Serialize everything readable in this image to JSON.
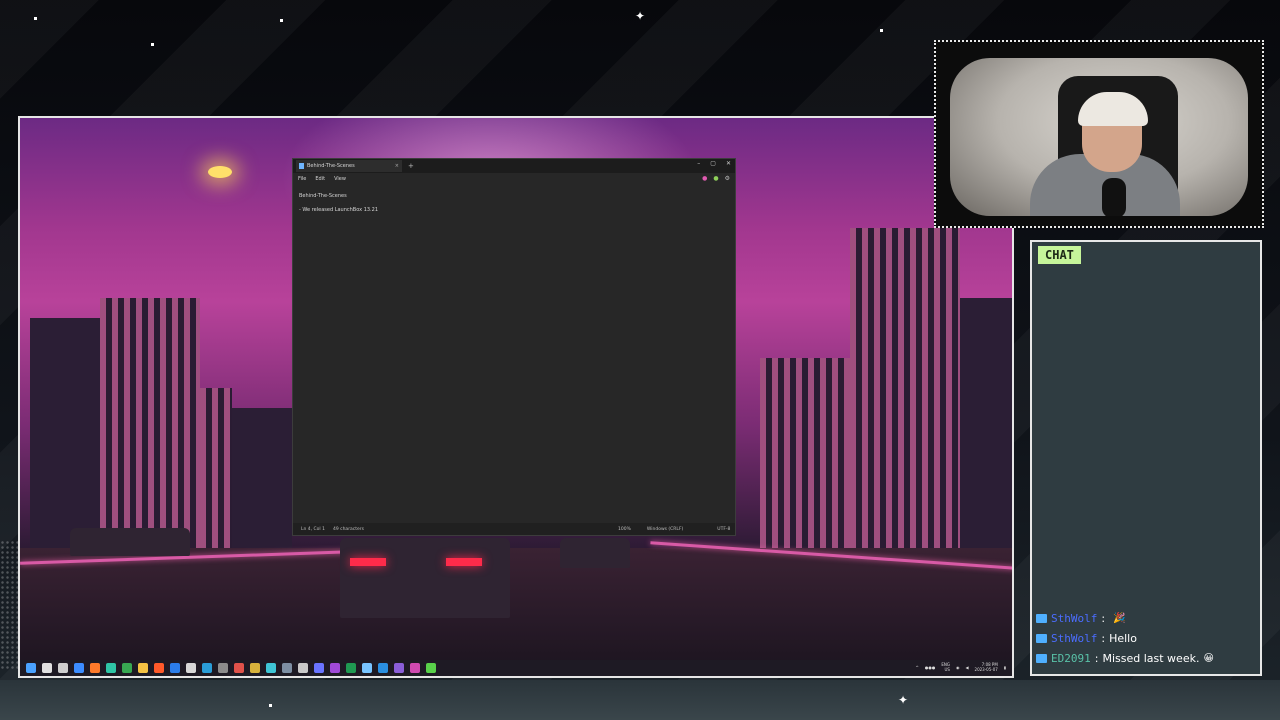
{
  "notepad": {
    "tab_title": "Behind-The-Scenes",
    "tab_close": "×",
    "new_tab": "+",
    "window_controls": [
      "–",
      "▢",
      "✕"
    ],
    "menu": [
      "File",
      "Edit",
      "View"
    ],
    "lines": [
      "Behind-The-Scenes",
      "- We released LaunchBox 13.21"
    ],
    "status": {
      "position": "Ln 4, Col 1",
      "characters": "49 characters",
      "zoom": "100%",
      "line_ending": "Windows (CRLF)",
      "encoding": "UTF-8"
    }
  },
  "taskbar": {
    "icons": [
      {
        "name": "start-icon",
        "color": "#4aa3ff"
      },
      {
        "name": "search-icon",
        "color": "#e0e0e0"
      },
      {
        "name": "task-view-icon",
        "color": "#cfcfcf"
      },
      {
        "name": "widgets-icon",
        "color": "#3c8dff"
      },
      {
        "name": "firefox-icon",
        "color": "#ff7a2a"
      },
      {
        "name": "edge-icon",
        "color": "#2fc6a6"
      },
      {
        "name": "chrome-icon",
        "color": "#38a852"
      },
      {
        "name": "explorer-icon",
        "color": "#f5c243"
      },
      {
        "name": "brave-icon",
        "color": "#ff5a2a"
      },
      {
        "name": "app-blue-icon",
        "color": "#2b7de9"
      },
      {
        "name": "store-icon",
        "color": "#d8d8d8"
      },
      {
        "name": "app-teal-icon",
        "color": "#2a9ed8"
      },
      {
        "name": "app-grey-icon",
        "color": "#8c8c8c"
      },
      {
        "name": "app-red-icon",
        "color": "#e0524a"
      },
      {
        "name": "app-yellow-icon",
        "color": "#d7b23c"
      },
      {
        "name": "app-cyan-icon",
        "color": "#3fc6d6"
      },
      {
        "name": "app-steam-icon",
        "color": "#7d8fa3"
      },
      {
        "name": "app-obs-icon",
        "color": "#c9c9c9"
      },
      {
        "name": "discord-icon",
        "color": "#6a74ff"
      },
      {
        "name": "app-purple-icon",
        "color": "#a04ad8"
      },
      {
        "name": "excel-icon",
        "color": "#1f9a52"
      },
      {
        "name": "notepad-icon",
        "color": "#78c4ff"
      },
      {
        "name": "vscode-icon",
        "color": "#2a8fe0"
      },
      {
        "name": "visual-studio-icon",
        "color": "#8b5ed8"
      },
      {
        "name": "app-magenta-icon",
        "color": "#d04ab0"
      },
      {
        "name": "app-green-icon",
        "color": "#59d14a"
      }
    ],
    "tray_lang": "ENG",
    "tray_region": "US",
    "time": "7:08 PM",
    "date": "2023-05-07"
  },
  "chat": {
    "title": "CHAT",
    "messages": [
      {
        "user": "SthWolf",
        "text": "",
        "emote": "🎉",
        "user_color": "#4b6dff"
      },
      {
        "user": "SthWolf",
        "text": "Hello",
        "emote": "",
        "user_color": "#4b6dff"
      },
      {
        "user": "ED2091",
        "text": "Missed last week.",
        "emote": "😀",
        "user_color": "#59c2a8"
      }
    ]
  }
}
